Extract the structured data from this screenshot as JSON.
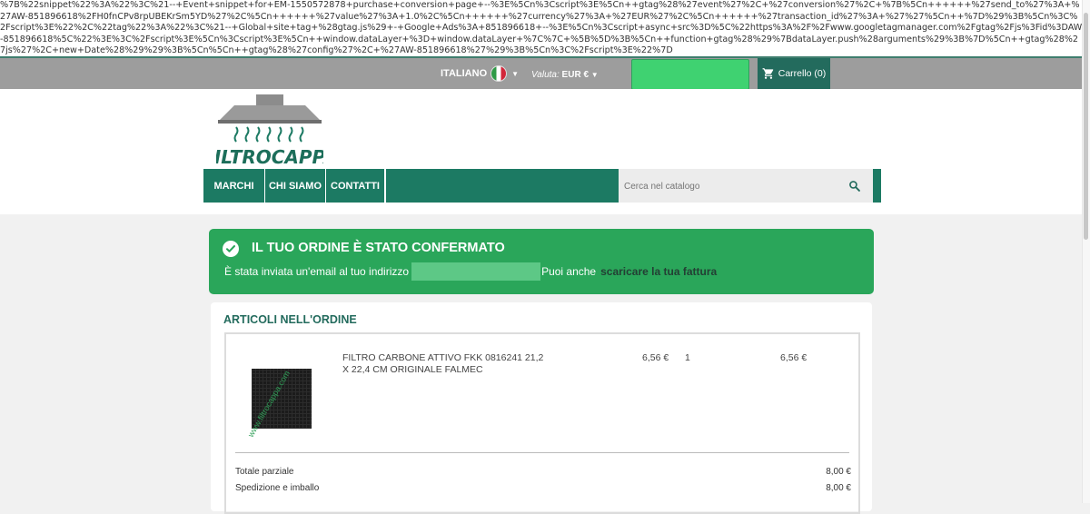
{
  "leaked_script": "%7B%22snippet%22%3A%22%3C%21--+Event+snippet+for+EM-1550572878+purchase+conversion+page+--%3E%5Cn%3Cscript%3E%5Cn++gtag%28%27event%27%2C+%27conversion%27%2C+%7B%5Cn++++++%27send_to%27%3A+%27AW-851896618%2FH0fnCPv8rpUBEKrSm5YD%27%2C%5Cn++++++%27value%27%3A+1.0%2C%5Cn++++++%27currency%27%3A+%27EUR%27%2C%5Cn++++++%27transaction_id%27%3A+%27%27%5Cn++%7D%29%3B%5Cn%3C%2Fscript%3E%22%2C%22tag%22%3A%22%3C%21--+Global+site+tag+%28gtag.js%29+-+Google+Ads%3A+851896618+--%3E%5Cn%3Cscript+async+src%3D%5C%22https%3A%2F%2Fwww.googletagmanager.com%2Fgtag%2Fjs%3Fid%3DAW-851896618%5C%22%3E%3C%2Fscript%3E%5Cn%3Cscript%3E%5Cn++window.dataLayer+%3D+window.dataLayer+%7C%7C+%5B%5D%3B%5Cn++function+gtag%28%29%7BdataLayer.push%28arguments%29%3B%7D%5Cn++gtag%28%27js%27%2C+new+Date%28%29%29%3B%5Cn%5Cn++gtag%28%27config%27%2C+%27AW-851896618%27%29%3B%5Cn%3C%2Fscript%3E%22%7D",
  "topbar": {
    "language": "ITALIANO",
    "currency_label": "Valuta:",
    "currency_value": "EUR €",
    "cart_label": "Carrello (0)",
    "colors": {
      "bar": "#9d9d9d",
      "cart": "#236b5d",
      "green_box": "#3fd271"
    }
  },
  "logo": {
    "text": "FILTROCAPPA"
  },
  "nav": {
    "items": [
      "MARCHI",
      "CHI SIAMO",
      "CONTATTI"
    ],
    "search_placeholder": "Cerca nel catalogo",
    "colors": {
      "nav": "#1c7a63"
    }
  },
  "confirmation": {
    "title": "IL TUO ORDINE È STATO CONFERMATO",
    "message_before": "È stata inviata un'email al tuo indirizzo",
    "message_after": "Puoi anche",
    "link_text": "scaricare la tua fattura",
    "colors": {
      "bg": "#2aa65a"
    }
  },
  "order": {
    "heading": "ARTICOLI NELL'ORDINE",
    "item": {
      "name": "FILTRO CARBONE ATTIVO FKK 0816241 21,2 X 22,4 CM ORIGINALE FALMEC",
      "unit_price": "6,56 €",
      "quantity": "1",
      "total": "6,56 €",
      "watermark": "www.filtrocappa.com"
    },
    "summary": [
      {
        "label": "Totale parziale",
        "value": "8,00 €"
      },
      {
        "label": "Spedizione e imballo",
        "value": "8,00 €"
      }
    ]
  }
}
